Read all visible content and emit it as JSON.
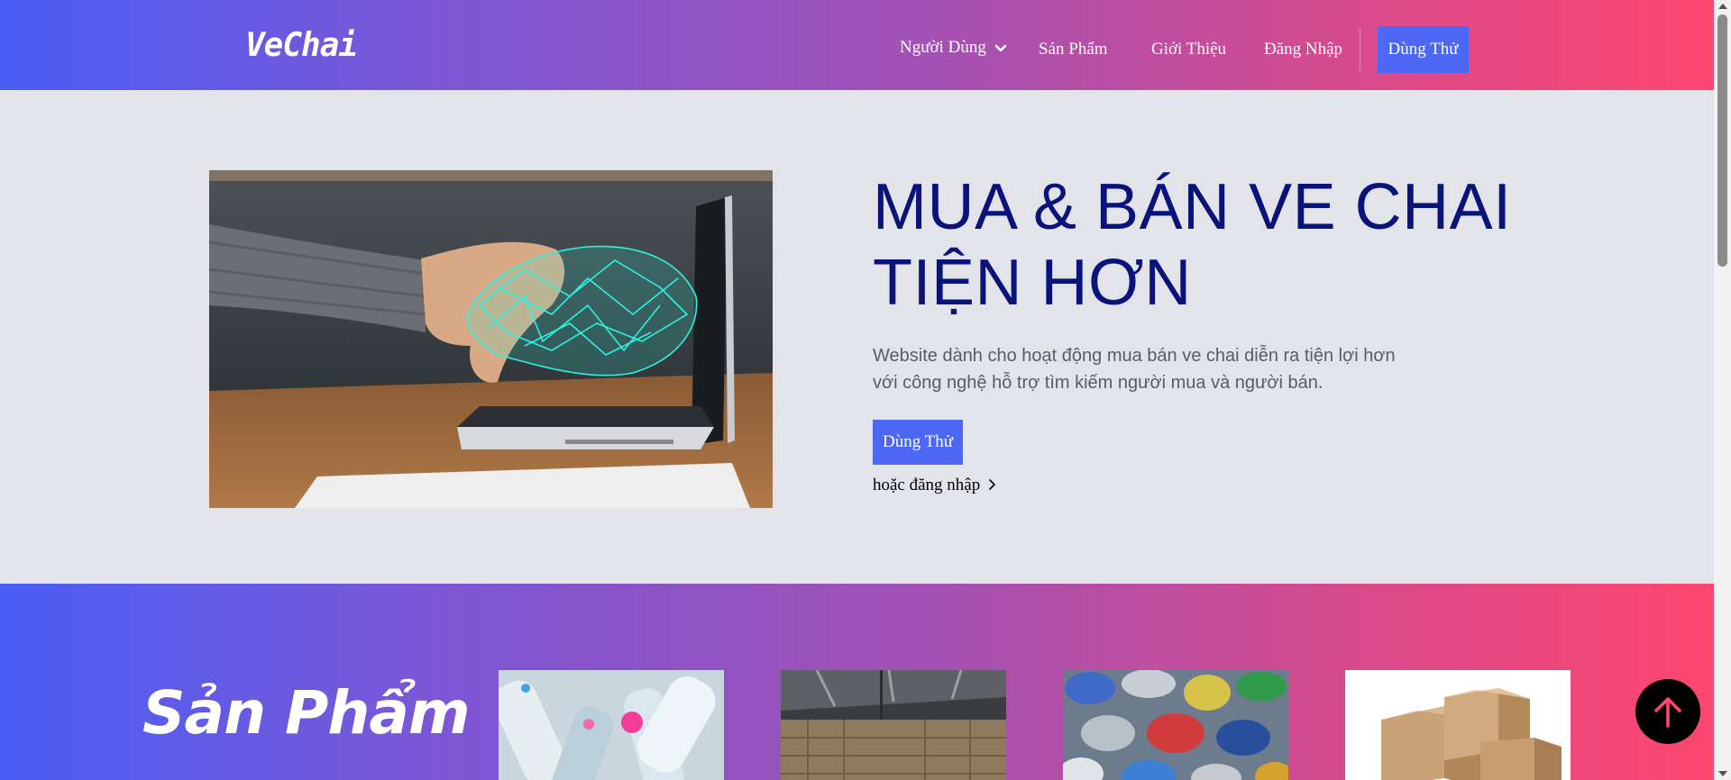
{
  "header": {
    "logo": "VeChai",
    "nav": {
      "user_label": "Người Dùng",
      "products_label": "Sản Phẩm",
      "about_label": "Giới Thiệu",
      "login_label": "Đăng Nhập",
      "try_label": "Dùng Thử"
    }
  },
  "hero": {
    "title_line1": "MUA & BÁN VE CHAI",
    "title_line2": "TIỆN HƠN",
    "desc_line1": "Website dành cho hoạt động mua bán ve chai diễn ra tiện lợi hơn",
    "desc_line2": "với công nghệ hỗ trợ tìm kiếm người mua và người bán.",
    "try_label": "Dùng Thử",
    "login_link": "hoặc đăng nhập"
  },
  "products": {
    "title": "Sản Phẩm"
  },
  "icons": {
    "dropdown": "chevron-down-icon",
    "login_arrow": "chevron-right-icon",
    "back_to_top": "arrow-up-icon"
  },
  "colors": {
    "brand_blue": "#4b67f3",
    "title_navy": "#0a137a",
    "gradient_start": "#4a5ef5",
    "gradient_end": "#fe4670",
    "hero_bg": "#e2e4ea",
    "back_top_icon": "#fe4670"
  }
}
